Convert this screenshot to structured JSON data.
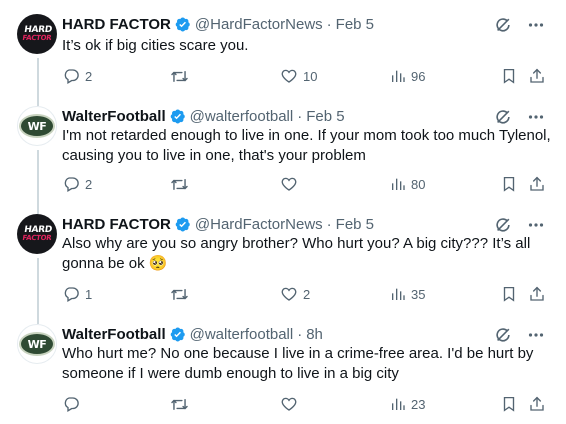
{
  "tweets": [
    {
      "name": "HARD FACTOR",
      "handle": "@HardFactorNews",
      "time": "Feb 5",
      "avatar_text_1": "HARD",
      "avatar_text_2": "FACTOR",
      "lines": [
        "It’s ok if big cities scare you."
      ],
      "replies": "2",
      "retweets": "",
      "likes": "10",
      "views": "96"
    },
    {
      "name": "WalterFootball",
      "handle": "@walterfootball",
      "time": "Feb 5",
      "avatar_text_1": "WF",
      "lines": [
        "I'm not retarded enough to live in one. If your mom took too much Tylenol,",
        "causing you to live in one, that's your problem"
      ],
      "replies": "2",
      "retweets": "",
      "likes": "",
      "views": "80"
    },
    {
      "name": "HARD FACTOR",
      "handle": "@HardFactorNews",
      "time": "Feb 5",
      "avatar_text_1": "HARD",
      "avatar_text_2": "FACTOR",
      "lines": [
        "Also why are you so angry brother? Who hurt you? A big city??? It’s all",
        "gonna be ok 🥺"
      ],
      "replies": "1",
      "retweets": "",
      "likes": "2",
      "views": "35"
    },
    {
      "name": "WalterFootball",
      "handle": "@walterfootball",
      "time": "8h",
      "avatar_text_1": "WF",
      "lines": [
        "Who hurt me? No one because I live in a crime-free area. I'd be hurt by",
        "someone if I were dumb enough to live in a big city"
      ],
      "replies": "",
      "retweets": "",
      "likes": "",
      "views": "23"
    }
  ],
  "separator": "·",
  "icons": {
    "verified": "verified-badge-icon",
    "grok": "grok-icon",
    "more": "more-icon",
    "reply": "reply-icon",
    "retweet": "retweet-icon",
    "like": "like-icon",
    "views": "views-icon",
    "bookmark": "bookmark-icon",
    "share": "share-icon"
  },
  "colors": {
    "text": "#0f1419",
    "secondary": "#536471",
    "verified": "#1d9bf0",
    "thread_line": "#cfd9de"
  }
}
